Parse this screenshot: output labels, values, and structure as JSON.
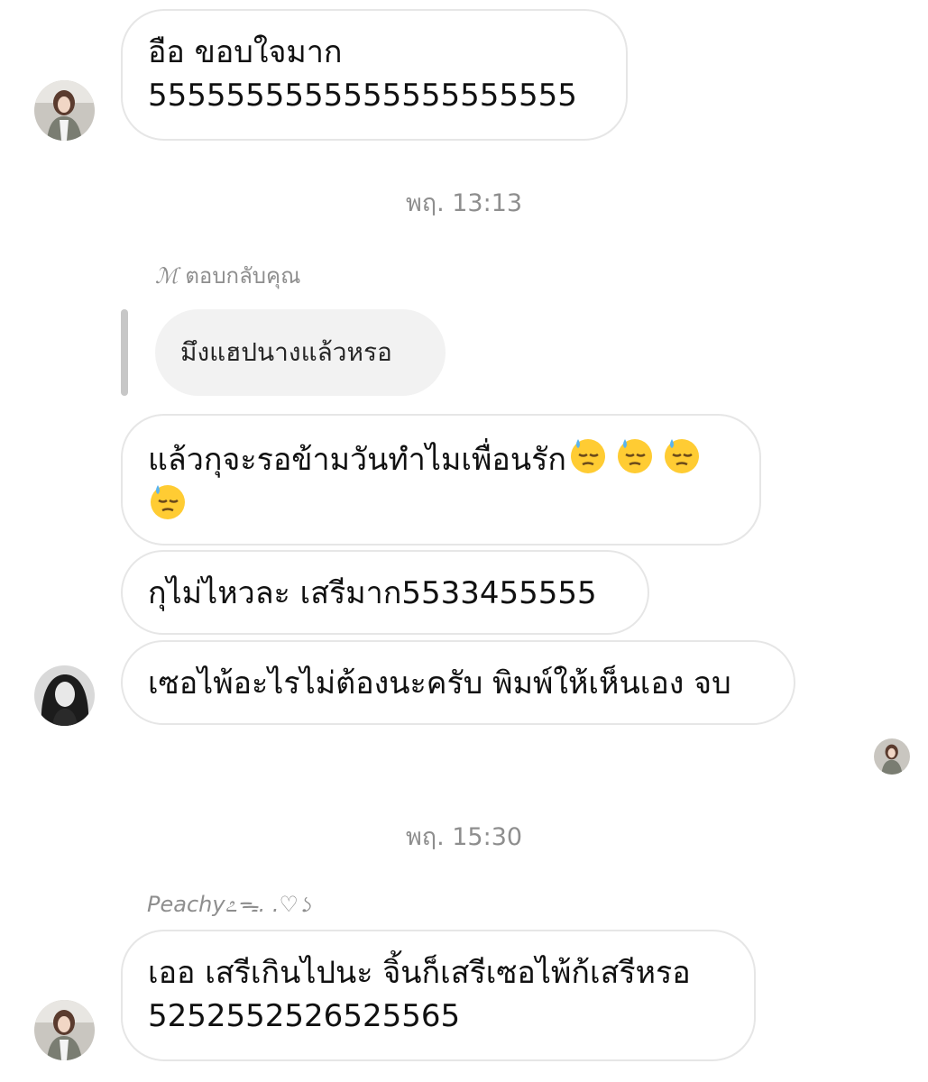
{
  "messages": {
    "m1": {
      "line1": "อือ ขอบใจมาก",
      "line2": "5555555555555555555555"
    },
    "m2": {
      "line1": "แล้วกุจะรอข้ามวันทำไมเพื่อนรัก"
    },
    "m3": {
      "text": "กุไม่ไหวละ เสรีมาก5533455555"
    },
    "m4": {
      "text": "เซอไพ้อะไรไม่ต้องนะครับ พิมพ์ให้เห็นเอง จบ"
    },
    "m5": {
      "line1": "เออ เสรีเกินไปนะ จิ้นก็เสรีเซอไพ้ก้เสรีหรอ",
      "line2": "5252552526525565"
    }
  },
  "timestamps": {
    "t1": "พฤ. 13:13",
    "t2": "พฤ. 15:30"
  },
  "reply": {
    "glyph": "ℳ",
    "label": "ตอบกลับคุณ",
    "quoted": "มึงแฮปนางแล้วหรอ"
  },
  "sender": {
    "name": "Peachy೭ᯓ. .♡১"
  },
  "emoji": {
    "name": "downcast-face-with-sweat",
    "count": 4
  },
  "colors": {
    "bubble_border": "#e6e6e6",
    "quote_bg": "#f2f2f2",
    "meta_text": "#8e8e8e"
  }
}
